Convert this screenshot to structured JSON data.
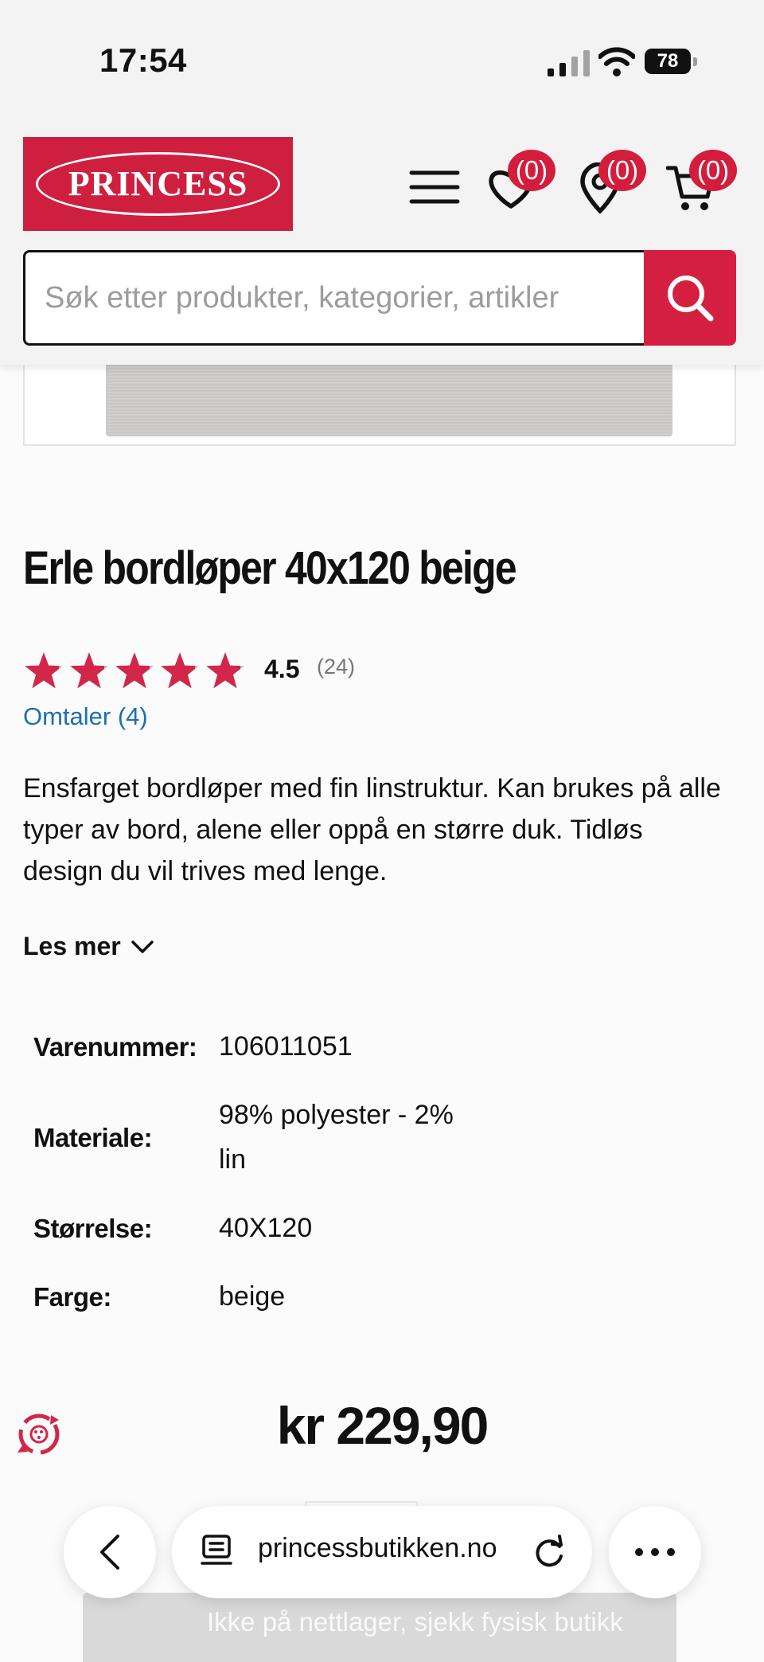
{
  "status_bar": {
    "time": "17:54",
    "battery": "78"
  },
  "header": {
    "brand": "PRINCESS",
    "wishlist_count": "(0)",
    "store_count": "(0)",
    "cart_count": "(0)",
    "search_placeholder": "Søk etter produkter, kategorier, artikler"
  },
  "product": {
    "title": "Erle bordløper 40x120 beige",
    "rating_value": "4.5",
    "rating_count": "(24)",
    "rating_fraction": 0.9,
    "reviews_link": "Omtaler (4)",
    "description": "Ensfarget bordløper med fin linstruktur. Kan brukes på alle typer av bord, alene eller oppå en større duk. Tidløs design du vil trives med lenge.",
    "read_more": "Les mer",
    "specs": [
      {
        "label": "Varenummer:",
        "value": "106011051"
      },
      {
        "label": "Materiale:",
        "value": "98% polyester - 2%",
        "value_line2": "lin"
      },
      {
        "label": "Størrelse:",
        "value": "40X120"
      },
      {
        "label": "Farge:",
        "value": "beige"
      }
    ],
    "price": "kr 229,90",
    "stock_message": "Ikke på nettlager, sjekk fysisk butikk"
  },
  "browser": {
    "url": "princessbutikken.no"
  },
  "colors": {
    "brand_red": "#cf1f3f",
    "link_blue": "#1c6fb3",
    "star_red": "#d22749",
    "star_gray": "#b7b7b7"
  }
}
